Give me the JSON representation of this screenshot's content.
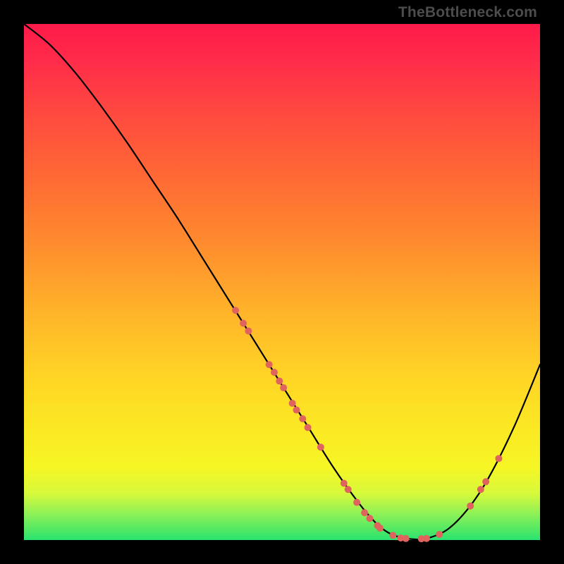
{
  "watermark": "TheBottleneck.com",
  "chart_data": {
    "type": "line",
    "title": "",
    "xlabel": "",
    "ylabel": "",
    "xlim": [
      0,
      100
    ],
    "ylim": [
      0,
      100
    ],
    "grid": false,
    "legend": false,
    "series": [
      {
        "name": "bottleneck-curve",
        "color": "#000000",
        "x": [
          0,
          5,
          10,
          15,
          20,
          25,
          30,
          35,
          40,
          45,
          50,
          55,
          60,
          65,
          68,
          70,
          72,
          75,
          78,
          82,
          86,
          90,
          95,
          100
        ],
        "y": [
          100,
          96,
          90.5,
          84,
          77,
          69.5,
          62,
          54,
          46,
          38,
          30,
          22,
          14,
          7,
          3.5,
          1.8,
          0.8,
          0.2,
          0.3,
          2,
          6,
          12,
          22,
          34
        ]
      }
    ],
    "scatter_points": {
      "name": "highlighted-points",
      "color": "#e0645e",
      "radius_px": 5,
      "points": [
        {
          "x": 41.0,
          "y": 44.5
        },
        {
          "x": 42.5,
          "y": 42.0
        },
        {
          "x": 43.5,
          "y": 40.5
        },
        {
          "x": 47.5,
          "y": 34.0
        },
        {
          "x": 48.5,
          "y": 32.5
        },
        {
          "x": 49.5,
          "y": 30.8
        },
        {
          "x": 50.3,
          "y": 29.5
        },
        {
          "x": 52.0,
          "y": 26.5
        },
        {
          "x": 52.8,
          "y": 25.2
        },
        {
          "x": 54.0,
          "y": 23.5
        },
        {
          "x": 55.0,
          "y": 21.8
        },
        {
          "x": 57.5,
          "y": 18.0
        },
        {
          "x": 62.0,
          "y": 11.0
        },
        {
          "x": 62.8,
          "y": 9.8
        },
        {
          "x": 64.5,
          "y": 7.3
        },
        {
          "x": 66.0,
          "y": 5.3
        },
        {
          "x": 67.0,
          "y": 4.2
        },
        {
          "x": 68.5,
          "y": 2.8
        },
        {
          "x": 69.0,
          "y": 2.3
        },
        {
          "x": 71.5,
          "y": 0.9
        },
        {
          "x": 73.0,
          "y": 0.4
        },
        {
          "x": 74.0,
          "y": 0.3
        },
        {
          "x": 77.0,
          "y": 0.25
        },
        {
          "x": 78.0,
          "y": 0.3
        },
        {
          "x": 80.5,
          "y": 1.1
        },
        {
          "x": 86.5,
          "y": 6.6
        },
        {
          "x": 88.5,
          "y": 9.8
        },
        {
          "x": 89.5,
          "y": 11.3
        },
        {
          "x": 92.0,
          "y": 15.8
        }
      ]
    }
  }
}
